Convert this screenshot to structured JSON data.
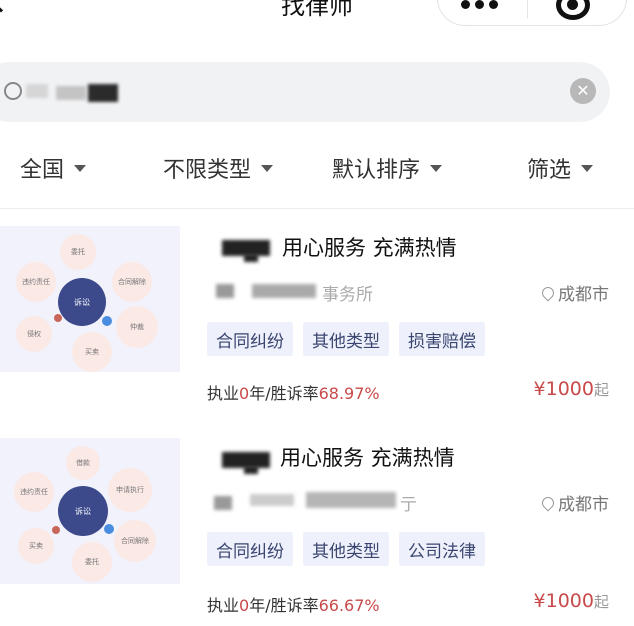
{
  "header": {
    "title": "找律师"
  },
  "search": {
    "value": ""
  },
  "filters": [
    {
      "label": "全国"
    },
    {
      "label": "不限类型"
    },
    {
      "label": "默认排序"
    },
    {
      "label": "筛选"
    }
  ],
  "lawyers": [
    {
      "headline": "用心服务 充满热情",
      "firm": "事务所",
      "location": "成都市",
      "tags": [
        "合同纠纷",
        "其他类型",
        "损害赔偿"
      ],
      "practice_prefix": "执业",
      "years": "0",
      "years_suffix": "年/胜诉率",
      "win_rate": "68.97%",
      "price": "¥1000",
      "price_suffix": "起",
      "thumb": {
        "core": "诉讼",
        "nodes": [
          "委托",
          "合同解除",
          "违约责任",
          "仲裁",
          "侵权",
          "买卖"
        ]
      }
    },
    {
      "headline": "用心服务 充满热情",
      "firm": "亍",
      "location": "成都市",
      "tags": [
        "合同纠纷",
        "其他类型",
        "公司法律"
      ],
      "practice_prefix": "执业",
      "years": "0",
      "years_suffix": "年/胜诉率",
      "win_rate": "66.67%",
      "price": "¥1000",
      "price_suffix": "起",
      "thumb": {
        "core": "诉讼",
        "nodes": [
          "借款",
          "申请执行",
          "违约责任",
          "合同解除",
          "买卖",
          "委托"
        ]
      }
    }
  ],
  "colors": {
    "accent_red": "#c94a4a",
    "tag_bg": "#eef1fb",
    "core_blue": "#3c4a8c"
  },
  "icons": {
    "back": "back-arrow-icon",
    "more": "more-dots-icon",
    "close": "mini-program-close-icon",
    "search": "search-icon",
    "clear": "clear-icon",
    "location": "location-pin-icon",
    "caret": "caret-down-icon"
  }
}
